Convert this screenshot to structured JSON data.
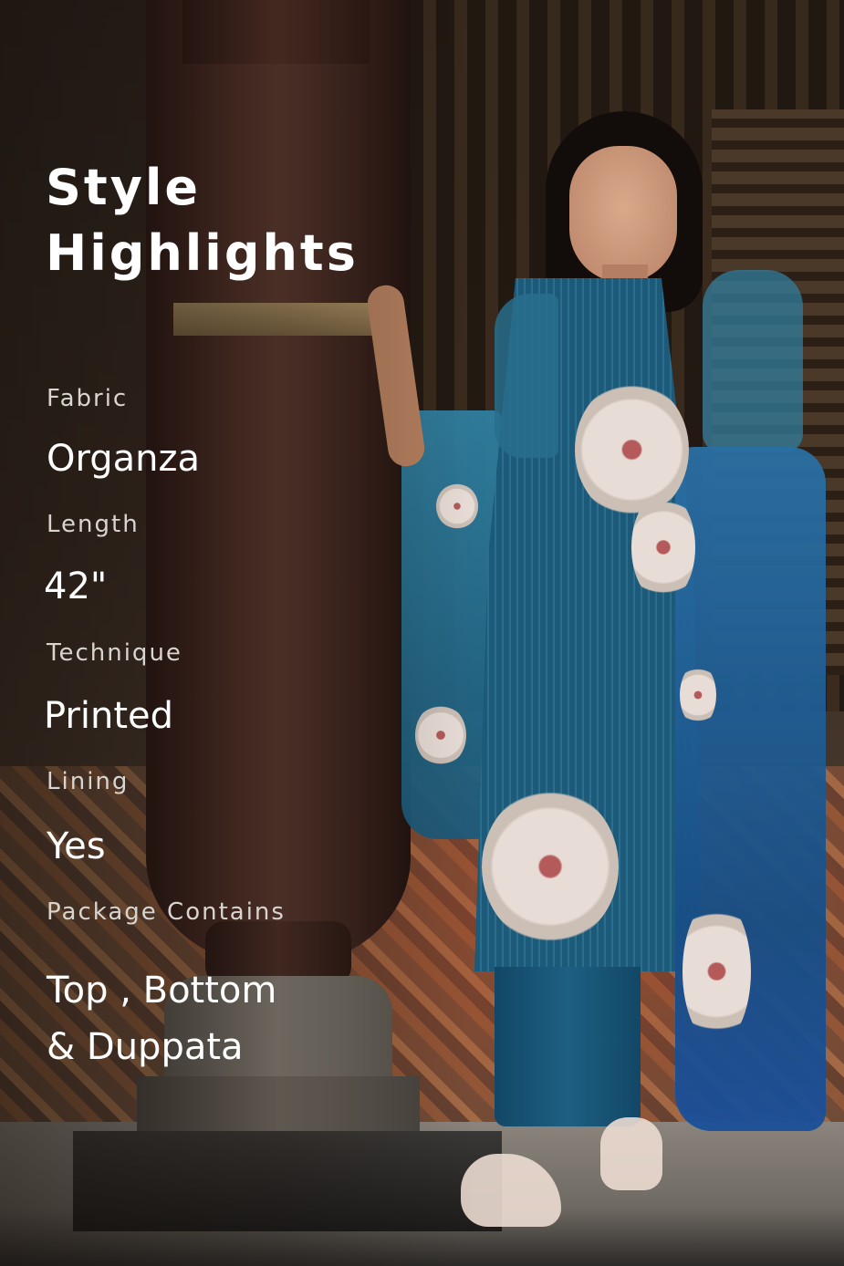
{
  "title": {
    "line1": "Style",
    "line2": "Highlights"
  },
  "highlights": [
    {
      "label": "Fabric",
      "value": "Organza"
    },
    {
      "label": "Length",
      "value": "42\""
    },
    {
      "label": "Technique",
      "value": "Printed"
    },
    {
      "label": "Lining",
      "value": "Yes"
    },
    {
      "label": "Package Contains",
      "value_lines": [
        "Top , Bottom",
        "& Duppata"
      ]
    }
  ],
  "colors": {
    "text": "#ffffff",
    "label_text": "#d8d4d0",
    "garment_blue": "#1d5a7a"
  }
}
